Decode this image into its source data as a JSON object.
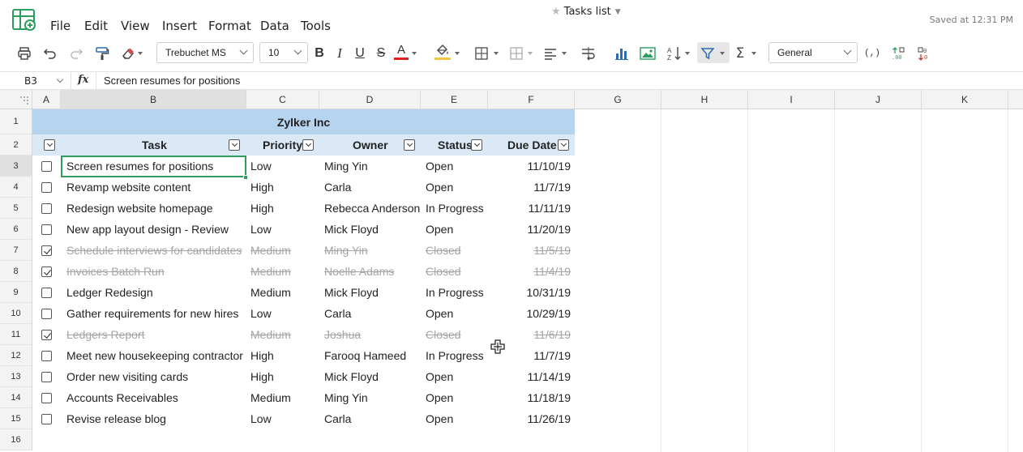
{
  "menubar": {
    "items": [
      "File",
      "Edit",
      "View",
      "Insert",
      "Format",
      "Data",
      "Tools"
    ],
    "doc_title": "Tasks list",
    "saved": "Saved at 12:31 PM"
  },
  "toolbar": {
    "font_family": "Trebuchet MS",
    "font_size": "10",
    "number_format": "General",
    "colors": {
      "font_color": "#e02020",
      "fill_color": "#f4c542"
    }
  },
  "formula_bar": {
    "cell_ref": "B3",
    "fx": "fx",
    "value": "Screen resumes for positions"
  },
  "columns": [
    "A",
    "B",
    "C",
    "D",
    "E",
    "F",
    "G",
    "H",
    "I",
    "J",
    "K"
  ],
  "rows": [
    "1",
    "2",
    "3",
    "4",
    "5",
    "6",
    "7",
    "8",
    "9",
    "10",
    "11",
    "12",
    "13",
    "14",
    "15",
    "16"
  ],
  "sheet": {
    "title": "Zylker Inc",
    "headers": [
      "Task",
      "Priority",
      "Owner",
      "Status",
      "Due Date"
    ],
    "tasks": [
      {
        "done": false,
        "task": "Screen resumes for positions",
        "priority": "Low",
        "owner": "Ming Yin",
        "status": "Open",
        "due": "11/10/19"
      },
      {
        "done": false,
        "task": "Revamp website content",
        "priority": "High",
        "owner": "Carla",
        "status": "Open",
        "due": "11/7/19"
      },
      {
        "done": false,
        "task": "Redesign website homepage",
        "priority": "High",
        "owner": "Rebecca Anderson",
        "status": "In Progress",
        "due": "11/11/19"
      },
      {
        "done": false,
        "task": "New app layout design - Review",
        "priority": "Low",
        "owner": "Mick Floyd",
        "status": "Open",
        "due": "11/20/19"
      },
      {
        "done": true,
        "task": "Schedule interviews for candidates",
        "priority": "Medium",
        "owner": "Ming Yin",
        "status": "Closed",
        "due": "11/5/19"
      },
      {
        "done": true,
        "task": "Invoices Batch Run",
        "priority": "Medium",
        "owner": "Noelle Adams",
        "status": "Closed",
        "due": "11/4/19"
      },
      {
        "done": false,
        "task": "Ledger Redesign",
        "priority": "Medium",
        "owner": "Mick Floyd",
        "status": "In Progress",
        "due": "10/31/19"
      },
      {
        "done": false,
        "task": "Gather requirements for new hires",
        "priority": "Low",
        "owner": "Carla",
        "status": "Open",
        "due": "10/29/19"
      },
      {
        "done": true,
        "task": "Ledgers Report",
        "priority": "Medium",
        "owner": "Joshua",
        "status": "Closed",
        "due": "11/6/19"
      },
      {
        "done": false,
        "task": "Meet new housekeeping contractor",
        "priority": "High",
        "owner": "Farooq Hameed",
        "status": "In Progress",
        "due": "11/7/19"
      },
      {
        "done": false,
        "task": "Order new visiting cards",
        "priority": "High",
        "owner": "Mick Floyd",
        "status": "Open",
        "due": "11/14/19"
      },
      {
        "done": false,
        "task": "Accounts Receivables",
        "priority": "Medium",
        "owner": "Ming Yin",
        "status": "Open",
        "due": "11/18/19"
      },
      {
        "done": false,
        "task": "Revise release blog",
        "priority": "Low",
        "owner": "Carla",
        "status": "Open",
        "due": "11/26/19"
      }
    ]
  }
}
